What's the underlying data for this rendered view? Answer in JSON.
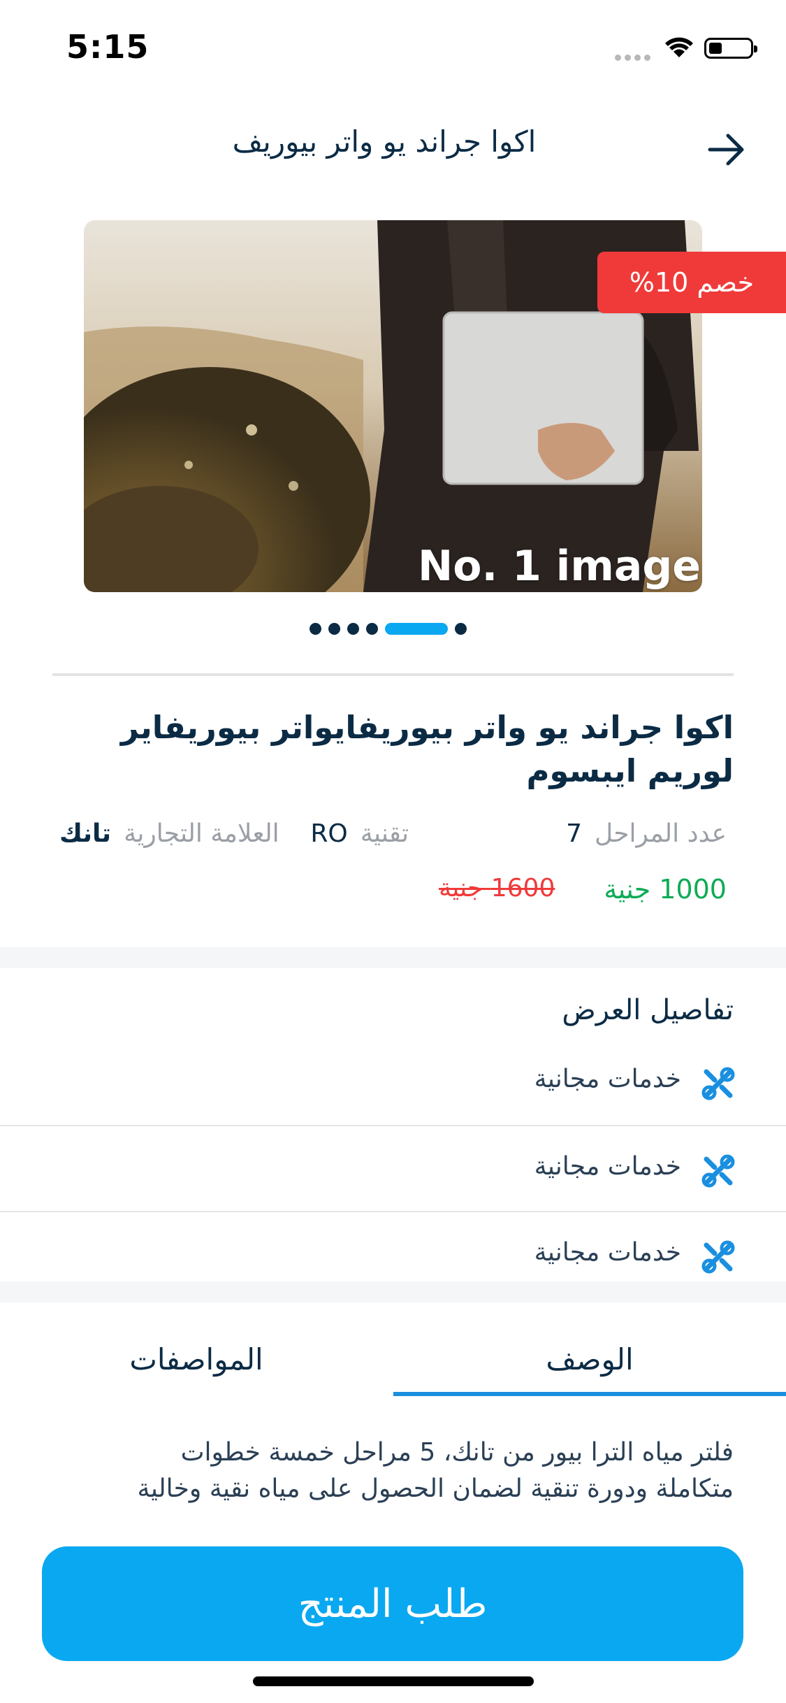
{
  "status_bar": {
    "time": "5:15"
  },
  "header": {
    "title": "اكوا جراند يو واتر بيوريف",
    "back_icon": "arrow-right-icon"
  },
  "gallery": {
    "discount_badge": "خصم 10%",
    "image_label": "No. 1 image",
    "dot_count": 6,
    "active_dot_index": 4
  },
  "product": {
    "title": "اكوا جراند يو واتر بيوريفايواتر بيوريفاير لوريم ايبسوم",
    "specs": {
      "stages_label": "عدد المراحل",
      "stages_value": "7",
      "tech_label": "تقنية",
      "tech_value": "RO",
      "brand_label": "العلامة التجارية",
      "brand_value": "تانك"
    },
    "price_new": "1000 جنية",
    "price_old": "1600 جنية"
  },
  "offer": {
    "title": "تفاصيل العرض",
    "items": [
      {
        "label": "خدمات مجانية",
        "icon": "tools-icon"
      },
      {
        "label": "خدمات مجانية",
        "icon": "tools-icon"
      },
      {
        "label": "خدمات مجانية",
        "icon": "tools-icon"
      }
    ]
  },
  "tabs": {
    "description": "الوصف",
    "specifications": "المواصفات",
    "active": "description"
  },
  "description": {
    "line1": "فلتر مياه الترا بيور من تانك، 5 مراحل خمسة خطوات",
    "line2": "متكاملة ودورة تنقية لضمان الحصول على مياه نقية وخالية"
  },
  "cta": {
    "order_label": "طلب المنتج"
  },
  "colors": {
    "primary": "#0aa8f0",
    "discount": "#f03a3a",
    "price_green": "#0eab55",
    "navy": "#0b2b45"
  }
}
